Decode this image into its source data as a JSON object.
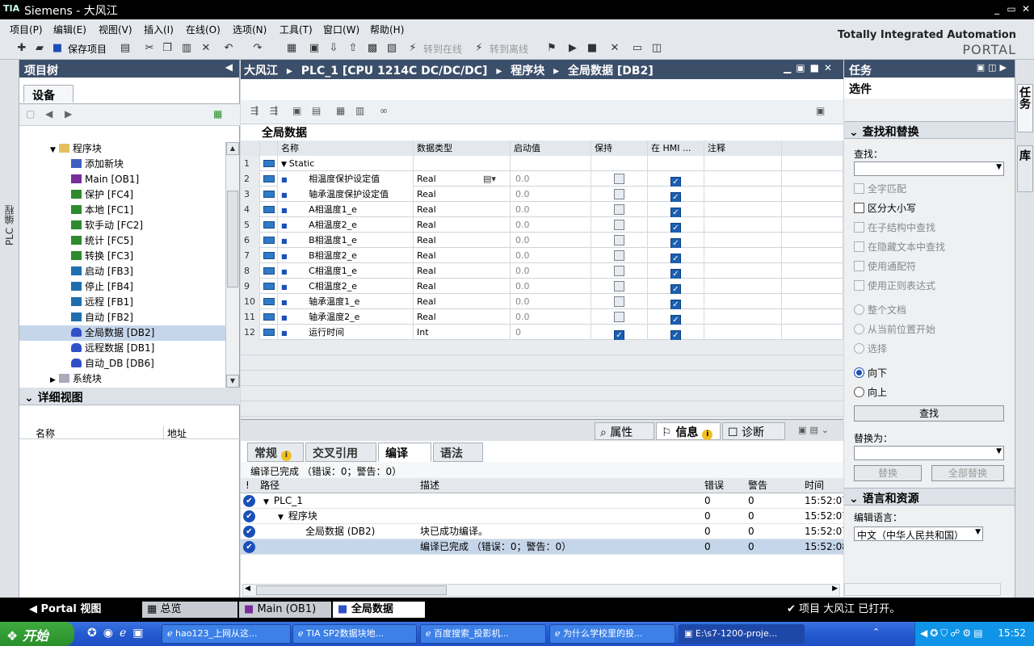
{
  "title_bar": {
    "logo": "TIA",
    "title": "Siemens  -  大风江",
    "min": "_",
    "restore": "▭",
    "close": "✕"
  },
  "menu": [
    "项目(P)",
    "编辑(E)",
    "视图(V)",
    "插入(I)",
    "在线(O)",
    "选项(N)",
    "工具(T)",
    "窗口(W)",
    "帮助(H)"
  ],
  "toolbar": {
    "save_project": "保存项目",
    "go_online": "转到在线",
    "go_offline": "转到离线"
  },
  "portal_brand": {
    "line1": "Totally Integrated Automation",
    "line2": "PORTAL"
  },
  "left_strip": {
    "label": "PLC 编程"
  },
  "project_tree": {
    "title": "项目树",
    "devices_tab": "设备",
    "items": [
      {
        "label": "程序块",
        "icon": "folder",
        "indent": 0,
        "expander": "▼"
      },
      {
        "label": "添加新块",
        "icon": "new",
        "indent": 1
      },
      {
        "label": "Main [OB1]",
        "icon": "ob",
        "indent": 1
      },
      {
        "label": "保护 [FC4]",
        "icon": "fc",
        "indent": 1
      },
      {
        "label": "本地 [FC1]",
        "icon": "fc",
        "indent": 1
      },
      {
        "label": "软手动 [FC2]",
        "icon": "fc",
        "indent": 1
      },
      {
        "label": "统计 [FC5]",
        "icon": "fc",
        "indent": 1
      },
      {
        "label": "转换 [FC3]",
        "icon": "fc",
        "indent": 1
      },
      {
        "label": "启动 [FB3]",
        "icon": "fb",
        "indent": 1
      },
      {
        "label": "停止 [FB4]",
        "icon": "fb",
        "indent": 1
      },
      {
        "label": "远程 [FB1]",
        "icon": "fb",
        "indent": 1
      },
      {
        "label": "自动 [FB2]",
        "icon": "fb",
        "indent": 1
      },
      {
        "label": "全局数据 [DB2]",
        "icon": "db",
        "indent": 1,
        "selected": true
      },
      {
        "label": "远程数据 [DB1]",
        "icon": "db",
        "indent": 1
      },
      {
        "label": "自动_DB [DB6]",
        "icon": "db",
        "indent": 1
      },
      {
        "label": "系统块",
        "icon": "sys",
        "indent": 0,
        "expander": "▶"
      }
    ]
  },
  "detail_view": {
    "title": "详细视图",
    "col_name": "名称",
    "col_address": "地址"
  },
  "editor": {
    "breadcrumb": [
      "大风江",
      "PLC_1 [CPU 1214C DC/DC/DC]",
      "程序块",
      "全局数据 [DB2]"
    ],
    "sep": "▸",
    "db_title": "全局数据",
    "columns": {
      "name": "名称",
      "type": "数据类型",
      "start": "启动值",
      "retain": "保持",
      "hmi": "在 HMI ...",
      "comment": "注释"
    },
    "static_label": "Static",
    "rows": [
      {
        "n": "1",
        "name": "Static",
        "type": "",
        "start": "",
        "retain": null,
        "hmi": null
      },
      {
        "n": "2",
        "name": "相温度保护设定值",
        "type": "Real",
        "start": "0.0",
        "retain": false,
        "hmi": true
      },
      {
        "n": "3",
        "name": "轴承温度保护设定值",
        "type": "Real",
        "start": "0.0",
        "retain": false,
        "hmi": true
      },
      {
        "n": "4",
        "name": "A相温度1_e",
        "type": "Real",
        "start": "0.0",
        "retain": false,
        "hmi": true
      },
      {
        "n": "5",
        "name": "A相温度2_e",
        "type": "Real",
        "start": "0.0",
        "retain": false,
        "hmi": true
      },
      {
        "n": "6",
        "name": "B相温度1_e",
        "type": "Real",
        "start": "0.0",
        "retain": false,
        "hmi": true
      },
      {
        "n": "7",
        "name": "B相温度2_e",
        "type": "Real",
        "start": "0.0",
        "retain": false,
        "hmi": true
      },
      {
        "n": "8",
        "name": "C相温度1_e",
        "type": "Real",
        "start": "0.0",
        "retain": false,
        "hmi": true
      },
      {
        "n": "9",
        "name": "C相温度2_e",
        "type": "Real",
        "start": "0.0",
        "retain": false,
        "hmi": true
      },
      {
        "n": "10",
        "name": "轴承温度1_e",
        "type": "Real",
        "start": "0.0",
        "retain": false,
        "hmi": true
      },
      {
        "n": "11",
        "name": "轴承温度2_e",
        "type": "Real",
        "start": "0.0",
        "retain": false,
        "hmi": true
      },
      {
        "n": "12",
        "name": "运行时间",
        "type": "Int",
        "start": "0",
        "retain": true,
        "hmi": true
      }
    ]
  },
  "inspector": {
    "props_tab": "属性",
    "info_tab": "信息",
    "diag_tab": "诊断",
    "tabs": [
      "常规",
      "交叉引用",
      "编译",
      "语法"
    ],
    "active_tab": "编译",
    "summary": "编译已完成 （错误：0；警告：0）",
    "columns": {
      "bang": "!",
      "path": "路径",
      "desc": "描述",
      "err": "错误",
      "warn": "警告",
      "time": "时间"
    },
    "rows": [
      {
        "path": "PLC_1",
        "indent": 0,
        "exp": "▼",
        "desc": "",
        "err": "0",
        "warn": "0",
        "time": "15:52:07"
      },
      {
        "path": "程序块",
        "indent": 1,
        "exp": "▼",
        "desc": "",
        "err": "0",
        "warn": "0",
        "time": "15:52:07"
      },
      {
        "path": "全局数据 (DB2)",
        "indent": 2,
        "exp": "",
        "desc": "块已成功编译。",
        "err": "0",
        "warn": "0",
        "time": "15:52:07"
      },
      {
        "path": "",
        "indent": 0,
        "exp": "",
        "desc": "编译已完成 （错误：0；警告：0）",
        "err": "0",
        "warn": "0",
        "time": "15:52:08",
        "selected": true
      }
    ]
  },
  "task_panel": {
    "title": "任务",
    "options": "选件",
    "find_replace": "查找和替换",
    "find_label": "查找：",
    "checks": [
      {
        "label": "全字匹配",
        "enabled": false
      },
      {
        "label": "区分大小写",
        "enabled": true
      },
      {
        "label": "在子结构中查找",
        "enabled": false
      },
      {
        "label": "在隐藏文本中查找",
        "enabled": false
      },
      {
        "label": "使用通配符",
        "enabled": false
      },
      {
        "label": "使用正则表达式",
        "enabled": false
      }
    ],
    "scopes": [
      {
        "label": "整个文档",
        "enabled": false
      },
      {
        "label": "从当前位置开始",
        "enabled": false
      },
      {
        "label": "选择",
        "enabled": false
      }
    ],
    "dirs": [
      {
        "label": "向下",
        "selected": true
      },
      {
        "label": "向上",
        "selected": false
      }
    ],
    "find_btn": "查找",
    "replace_label": "替换为：",
    "replace_btn": "替换",
    "replace_all_btn": "全部替换",
    "lang_res": "语言和资源",
    "edit_lang_label": "编辑语言：",
    "edit_lang_value": "中文（中华人民共和国）"
  },
  "right_strip": {
    "tasks": "任务",
    "library": "库"
  },
  "status_bar": {
    "portal_view": "Portal 视图",
    "overview": "总览",
    "main_ob1": "Main (OB1)",
    "global_data": "全局数据",
    "message": "项目 大风江 已打开。"
  },
  "taskbar": {
    "start": "开始",
    "tasks": [
      "hao123_上网从这...",
      "TIA SP2数据块地...",
      "百度搜索_投影机...",
      "为什么学校里的投...",
      "E:\\s7-1200-proje..."
    ],
    "clock": "15:52"
  }
}
